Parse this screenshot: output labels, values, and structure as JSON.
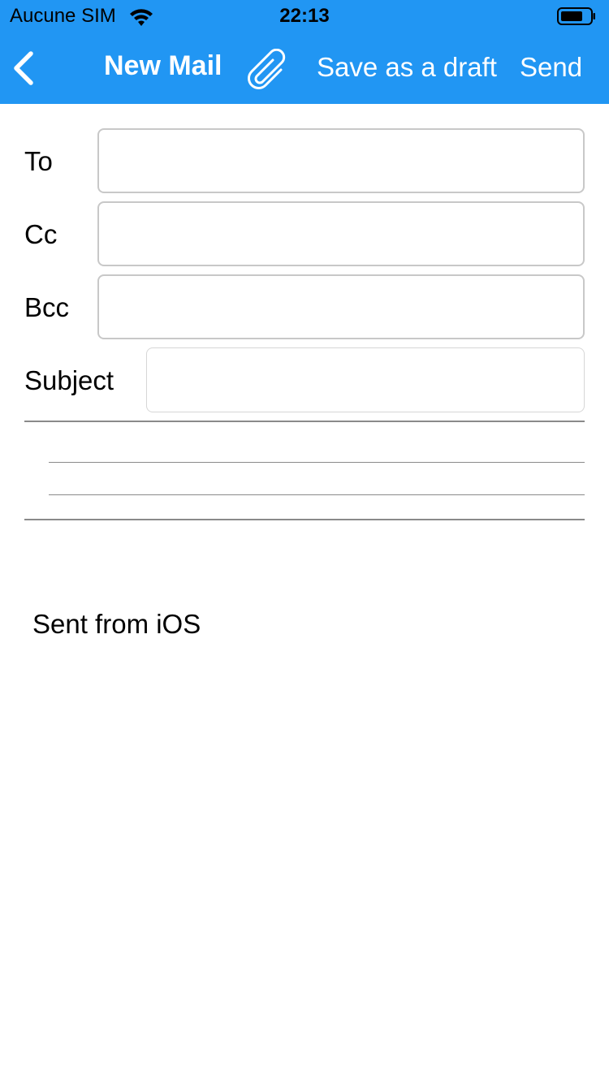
{
  "status_bar": {
    "carrier": "Aucune SIM",
    "time": "22:13",
    "wifi_icon": "wifi-icon",
    "battery_icon": "battery-icon"
  },
  "nav": {
    "back_icon": "chevron-left-icon",
    "title": "New Mail",
    "attach_icon": "paperclip-icon",
    "save_draft_label": "Save as a draft",
    "send_label": "Send"
  },
  "form": {
    "to": {
      "label": "To",
      "value": ""
    },
    "cc": {
      "label": "Cc",
      "value": ""
    },
    "bcc": {
      "label": "Bcc",
      "value": ""
    },
    "subject": {
      "label": "Subject",
      "value": ""
    }
  },
  "body": {
    "signature": "Sent from iOS"
  },
  "colors": {
    "accent": "#2196f3",
    "text": "#000000",
    "input_border": "#c8c8c8",
    "divider": "#8a8a8a"
  }
}
